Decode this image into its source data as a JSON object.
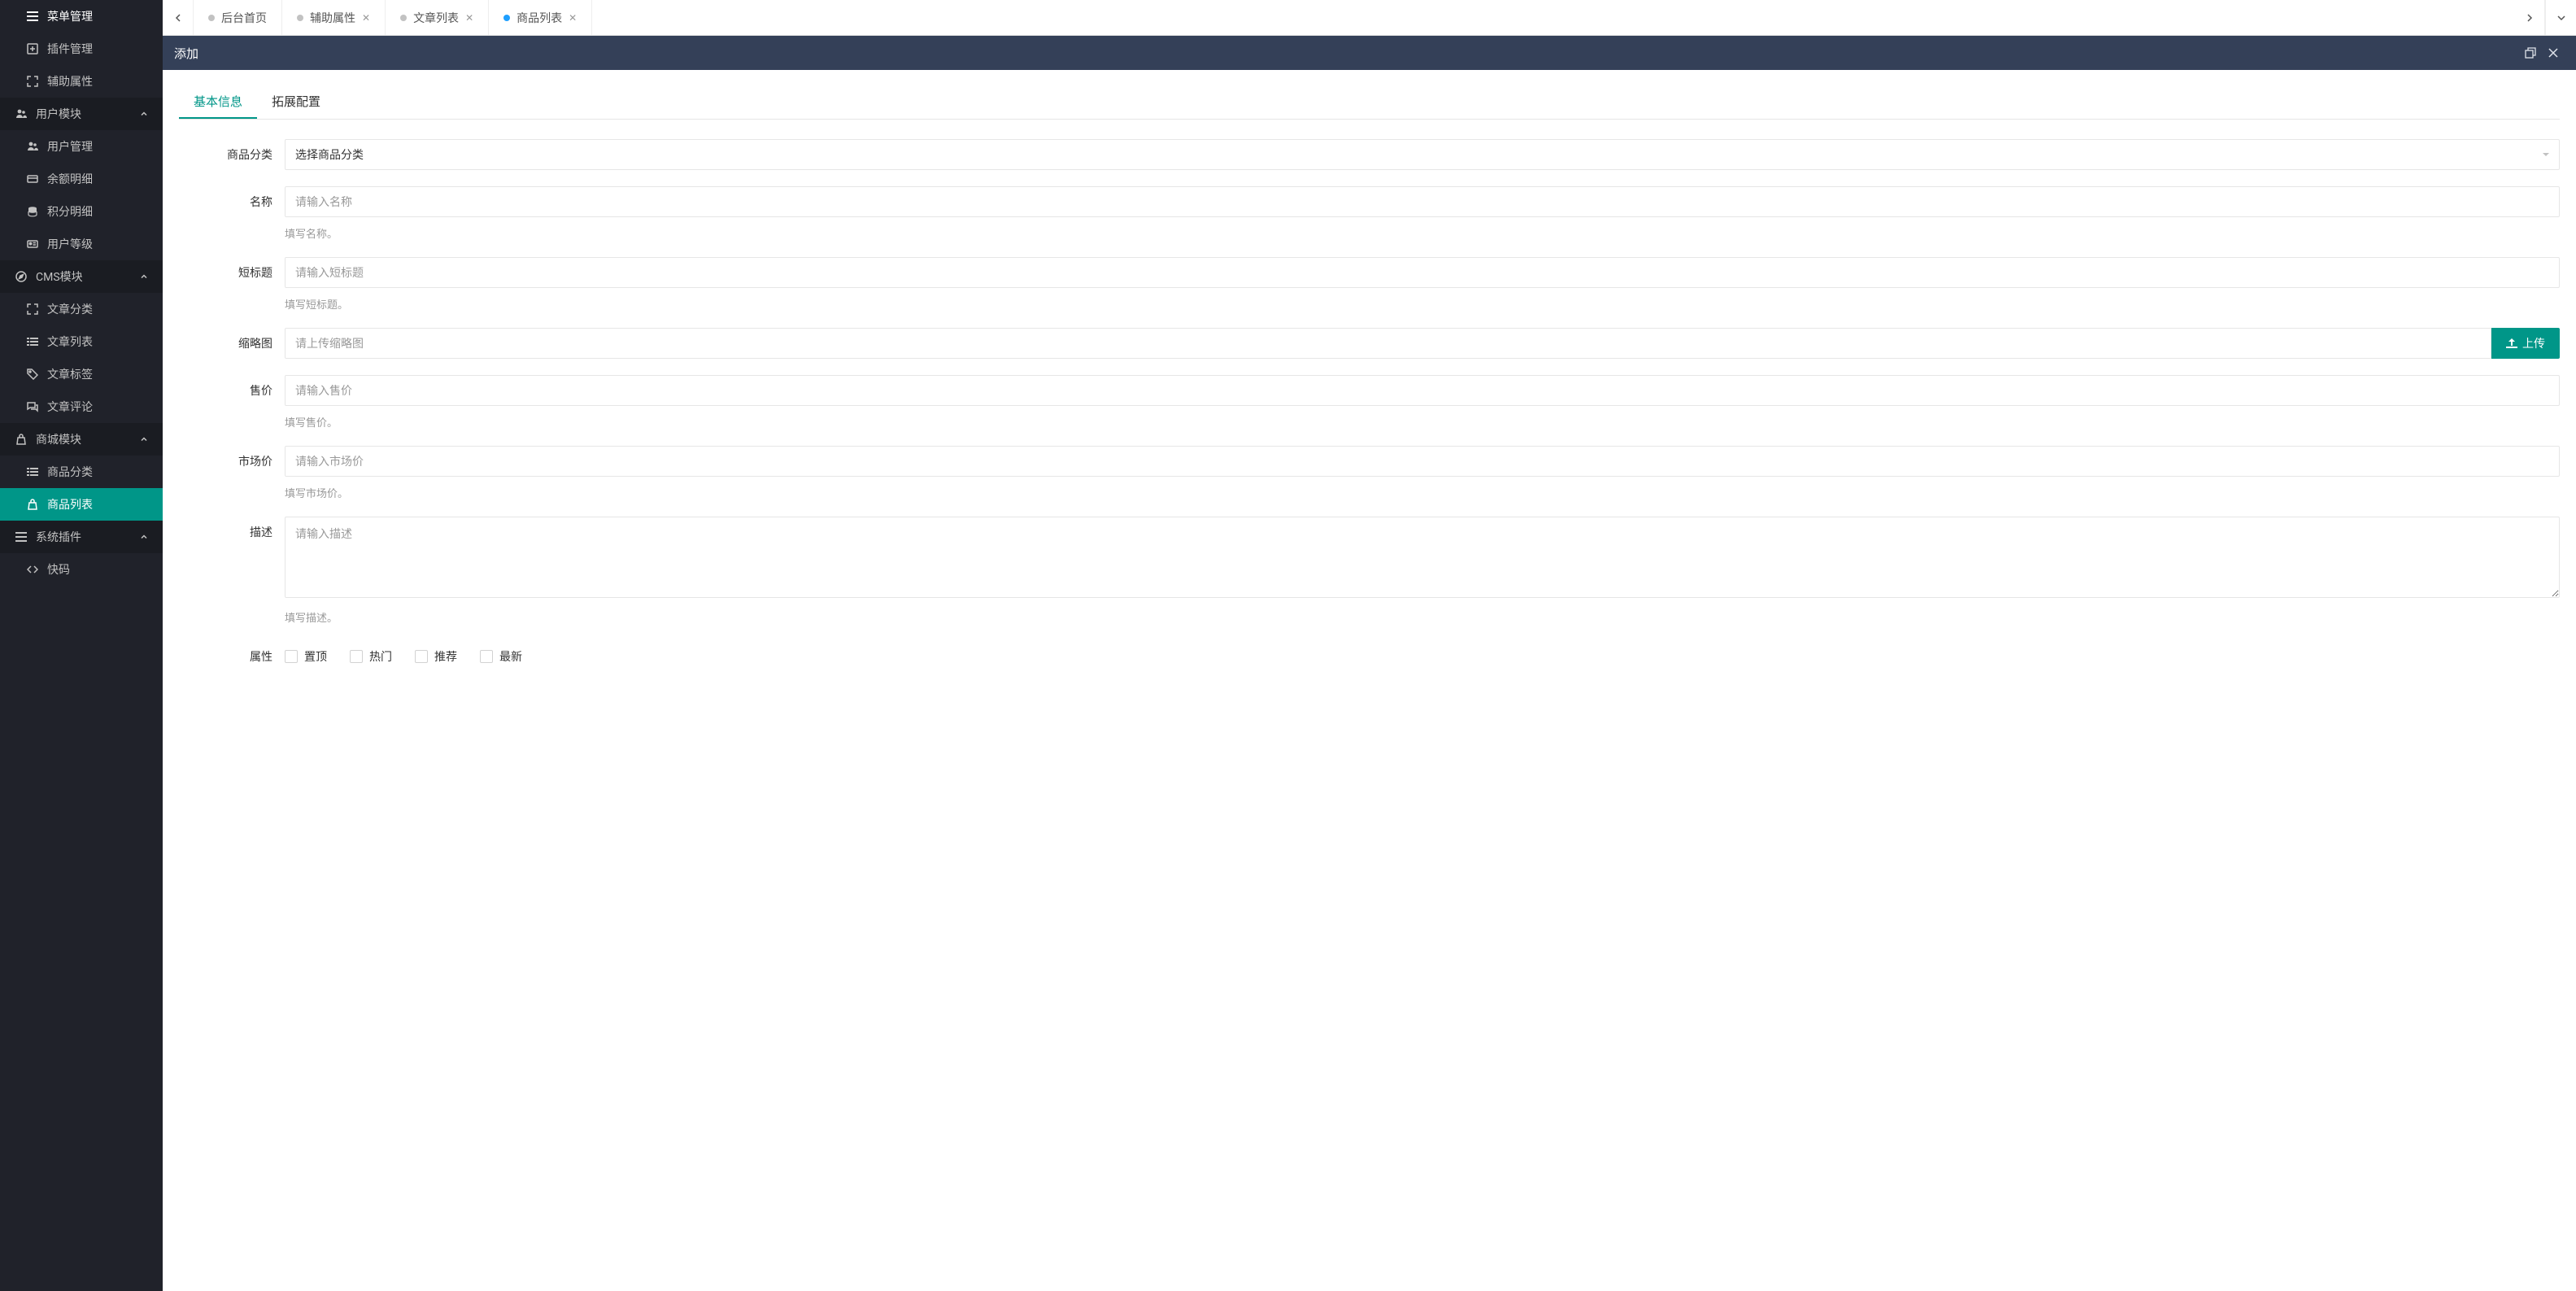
{
  "sidebar": {
    "items": [
      {
        "label": "菜单管理",
        "icon": "bars"
      },
      {
        "label": "插件管理",
        "icon": "plus-square"
      },
      {
        "label": "辅助属性",
        "icon": "expand"
      }
    ],
    "groups": [
      {
        "label": "用户模块",
        "icon": "users",
        "items": [
          {
            "label": "用户管理",
            "icon": "users"
          },
          {
            "label": "余额明细",
            "icon": "card"
          },
          {
            "label": "积分明细",
            "icon": "database"
          },
          {
            "label": "用户等级",
            "icon": "id-card"
          }
        ]
      },
      {
        "label": "CMS模块",
        "icon": "compass",
        "items": [
          {
            "label": "文章分类",
            "icon": "expand"
          },
          {
            "label": "文章列表",
            "icon": "list"
          },
          {
            "label": "文章标签",
            "icon": "tag"
          },
          {
            "label": "文章评论",
            "icon": "comments"
          }
        ]
      },
      {
        "label": "商城模块",
        "icon": "shopping-bag",
        "items": [
          {
            "label": "商品分类",
            "icon": "list"
          },
          {
            "label": "商品列表",
            "icon": "shopping-bag",
            "active": true
          }
        ]
      },
      {
        "label": "系统插件",
        "icon": "bars",
        "items": [
          {
            "label": "快码",
            "icon": "code"
          }
        ]
      }
    ]
  },
  "tabs": [
    {
      "label": "后台首页",
      "closable": false
    },
    {
      "label": "辅助属性",
      "closable": true
    },
    {
      "label": "文章列表",
      "closable": true
    },
    {
      "label": "商品列表",
      "closable": true,
      "active": true
    }
  ],
  "drawer": {
    "title": "添加"
  },
  "innerTabs": [
    {
      "label": "基本信息",
      "active": true
    },
    {
      "label": "拓展配置"
    }
  ],
  "form": {
    "categoryLabel": "商品分类",
    "categoryPlaceholder": "选择商品分类",
    "nameLabel": "名称",
    "namePlaceholder": "请输入名称",
    "nameHint": "填写名称。",
    "shortTitleLabel": "短标题",
    "shortTitlePlaceholder": "请输入短标题",
    "shortTitleHint": "填写短标题。",
    "thumbLabel": "缩略图",
    "thumbPlaceholder": "请上传缩略图",
    "uploadButton": "上传",
    "priceLabel": "售价",
    "pricePlaceholder": "请输入售价",
    "priceHint": "填写售价。",
    "marketPriceLabel": "市场价",
    "marketPricePlaceholder": "请输入市场价",
    "marketPriceHint": "填写市场价。",
    "descLabel": "描述",
    "descPlaceholder": "请输入描述",
    "descHint": "填写描述。",
    "attrLabel": "属性",
    "attrs": [
      "置顶",
      "热门",
      "推荐",
      "最新"
    ]
  }
}
